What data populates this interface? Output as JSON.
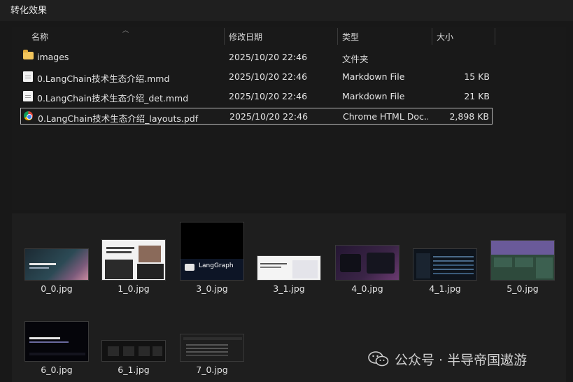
{
  "window": {
    "title": "转化效果"
  },
  "columns": {
    "name": "名称",
    "date": "修改日期",
    "type": "类型",
    "size": "大小"
  },
  "files": [
    {
      "name": "images",
      "date": "2025/10/20 22:46",
      "type": "文件夹",
      "size": "",
      "icon": "folder-icon"
    },
    {
      "name": "0.LangChain技术生态介绍.mmd",
      "date": "2025/10/20 22:46",
      "type": "Markdown File",
      "size": "15 KB",
      "icon": "document-icon"
    },
    {
      "name": "0.LangChain技术生态介绍_det.mmd",
      "date": "2025/10/20 22:46",
      "type": "Markdown File",
      "size": "21 KB",
      "icon": "document-icon"
    },
    {
      "name": "0.LangChain技术生态介绍_layouts.pdf",
      "date": "2025/10/20 22:46",
      "type": "Chrome HTML Doc...",
      "size": "2,898 KB",
      "icon": "chrome-icon",
      "selected": true
    }
  ],
  "thumbnails": [
    {
      "label": "0_0.jpg"
    },
    {
      "label": "1_0.jpg"
    },
    {
      "label": "3_0.jpg",
      "caption": "LangGraph"
    },
    {
      "label": "3_1.jpg"
    },
    {
      "label": "4_0.jpg"
    },
    {
      "label": "4_1.jpg"
    },
    {
      "label": "5_0.jpg"
    },
    {
      "label": "6_0.jpg"
    },
    {
      "label": "6_1.jpg"
    },
    {
      "label": "7_0.jpg"
    }
  ],
  "watermark": {
    "text": "公众号 · 半导帝国遨游",
    "icon": "wechat-icon"
  }
}
